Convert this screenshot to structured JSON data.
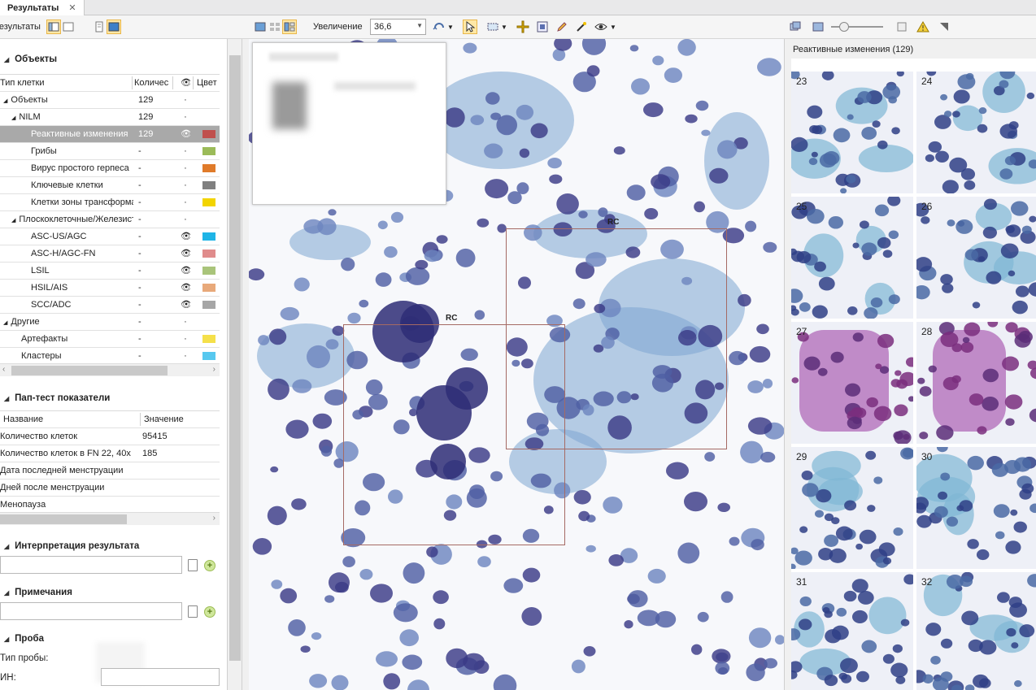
{
  "tab": {
    "title": "Результаты",
    "close": "✕"
  },
  "toolbar": {
    "left_label": "Результаты",
    "zoom_label": "Увеличение",
    "zoom_value": "36,6"
  },
  "objects": {
    "heading": "Объекты",
    "columns": [
      "Тип клетки",
      "Количес",
      "👁",
      "Цвет"
    ],
    "rows": [
      {
        "name": "Объекты",
        "count": "129",
        "eye": "·",
        "color": "",
        "indent": 0
      },
      {
        "name": "NILM",
        "count": "129",
        "eye": "·",
        "color": "",
        "indent": 1
      },
      {
        "name": "Реактивные изменения",
        "count": "129",
        "eye": "👁",
        "color": "#c0504d",
        "indent": 2,
        "selected": true
      },
      {
        "name": "Грибы",
        "count": "-",
        "eye": "·",
        "color": "#9bbb59",
        "indent": 2
      },
      {
        "name": "Вирус простого герпеса",
        "count": "-",
        "eye": "·",
        "color": "#e07b2a",
        "indent": 2
      },
      {
        "name": "Ключевые клетки",
        "count": "-",
        "eye": "·",
        "color": "#808080",
        "indent": 2
      },
      {
        "name": "Клетки зоны трансформации",
        "count": "-",
        "eye": "·",
        "color": "#f2d400",
        "indent": 2
      },
      {
        "name": "Плоскоклеточные/Железистые",
        "count": "-",
        "eye": "·",
        "color": "",
        "indent": 1
      },
      {
        "name": "ASC-US/AGC",
        "count": "-",
        "eye": "👁",
        "color": "#1fb4e6",
        "indent": 2
      },
      {
        "name": "ASC-H/AGC-FN",
        "count": "-",
        "eye": "👁",
        "color": "#e08c8c",
        "indent": 2
      },
      {
        "name": "LSIL",
        "count": "-",
        "eye": "👁",
        "color": "#a9c47a",
        "indent": 2
      },
      {
        "name": "HSIL/AIS",
        "count": "-",
        "eye": "👁",
        "color": "#e8a97a",
        "indent": 2
      },
      {
        "name": "SCC/ADC",
        "count": "-",
        "eye": "👁",
        "color": "#a6a6a6",
        "indent": 2
      },
      {
        "name": "Другие",
        "count": "-",
        "eye": "·",
        "color": "",
        "indent": 0
      },
      {
        "name": "Артефакты",
        "count": "-",
        "eye": "·",
        "color": "#f5e04a",
        "indent": 1
      },
      {
        "name": "Кластеры",
        "count": "-",
        "eye": "·",
        "color": "#57c8ef",
        "indent": 1
      }
    ]
  },
  "pap": {
    "heading": "Пап-тест показатели",
    "columns": [
      "Название",
      "Значение"
    ],
    "rows": [
      {
        "name": "Количество клеток",
        "value": "95415"
      },
      {
        "name": "Количество клеток в FN 22, 40x",
        "value": "185"
      },
      {
        "name": "Дата последней менструации",
        "value": ""
      },
      {
        "name": "Дней после менструации",
        "value": ""
      },
      {
        "name": "Менопауза",
        "value": ""
      }
    ]
  },
  "interpretation": {
    "heading": "Интерпретация результата"
  },
  "notes": {
    "heading": "Примечания"
  },
  "sample": {
    "heading": "Проба",
    "type_label": "Тип пробы:",
    "id_label": "ИН:"
  },
  "viewer": {
    "roi_label": "RC"
  },
  "right": {
    "title": "Реактивные изменения (129)",
    "thumbnails": [
      "23",
      "24",
      "25",
      "26",
      "27",
      "28",
      "29",
      "30",
      "31",
      "32"
    ]
  },
  "colors": {
    "accent": "#e8b64a",
    "selection": "#a9a9a9",
    "roi": "#a56a64",
    "cell_stain": "#3b3a86"
  }
}
